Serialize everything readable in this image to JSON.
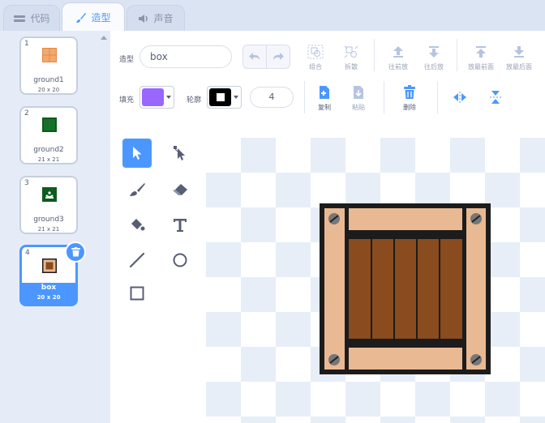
{
  "tabs": [
    {
      "label": "代码",
      "icon": "code-icon"
    },
    {
      "label": "造型",
      "icon": "brush-icon"
    },
    {
      "label": "声音",
      "icon": "speaker-icon"
    }
  ],
  "costumes": [
    {
      "index": "1",
      "name": "ground1",
      "size": "20 x 20",
      "thumb": "ground1-thumb"
    },
    {
      "index": "2",
      "name": "ground2",
      "size": "21 x 21",
      "thumb": "ground2-thumb"
    },
    {
      "index": "3",
      "name": "ground3",
      "size": "21 x 21",
      "thumb": "ground3-thumb"
    },
    {
      "index": "4",
      "name": "box",
      "size": "20 x 20",
      "thumb": "box-thumb",
      "selected": true
    }
  ],
  "editor": {
    "costume_label": "造型",
    "costume_name": "box",
    "fill_label": "填充",
    "outline_label": "轮廓",
    "outline_width": "4",
    "fill_color": "#9966ff",
    "outline_color": "#000000",
    "toolbar_top": {
      "group": "组合",
      "ungroup": "拆散",
      "forward": "往前放",
      "backward": "往后放",
      "front": "放最前面",
      "back": "放最后面"
    },
    "toolbar_bottom": {
      "copy": "复制",
      "paste": "粘贴",
      "delete": "删除"
    }
  },
  "colors": {
    "accent": "#4c97ff",
    "crate_light": "#e9b993",
    "crate_dark": "#8a4b1f",
    "crate_outline": "#1c1c1c"
  }
}
